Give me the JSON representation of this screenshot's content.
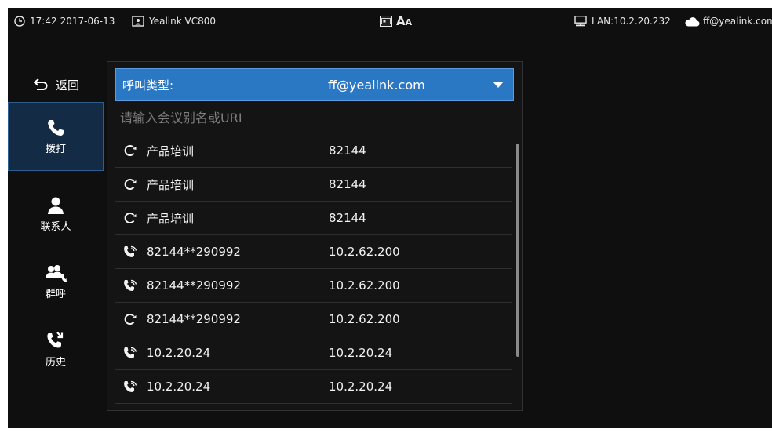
{
  "statusbar": {
    "time": "17:42",
    "date": "2017-06-13",
    "device_name": "Yealink VC800",
    "center_text": "A",
    "center_subscript": "A",
    "lan": "LAN:10.2.20.232",
    "account": "ff@yealink.com"
  },
  "nav": {
    "back_label": "返回",
    "items": [
      {
        "label": "拨打",
        "icon": "phone-icon",
        "active": true
      },
      {
        "label": "联系人",
        "icon": "contact-icon",
        "active": false
      },
      {
        "label": "群呼",
        "icon": "group-call-icon",
        "active": false
      },
      {
        "label": "历史",
        "icon": "history-icon",
        "active": false
      }
    ]
  },
  "call": {
    "type_label": "呼叫类型:",
    "type_value": "ff@yealink.com",
    "search_placeholder": "请输入会议别名或URI"
  },
  "entries": [
    {
      "icon": "cloud-conference-icon",
      "name": "产品培训",
      "number": "82144"
    },
    {
      "icon": "cloud-conference-icon",
      "name": "产品培训",
      "number": "82144"
    },
    {
      "icon": "cloud-conference-icon",
      "name": "产品培训",
      "number": "82144"
    },
    {
      "icon": "phone-call-icon",
      "name": "82144**290992",
      "number": "10.2.62.200"
    },
    {
      "icon": "phone-call-icon",
      "name": "82144**290992",
      "number": "10.2.62.200"
    },
    {
      "icon": "cloud-conference-icon",
      "name": "82144**290992",
      "number": "10.2.62.200"
    },
    {
      "icon": "phone-call-icon",
      "name": "10.2.20.24",
      "number": "10.2.20.24"
    },
    {
      "icon": "phone-call-icon",
      "name": "10.2.20.24",
      "number": "10.2.20.24"
    }
  ]
}
